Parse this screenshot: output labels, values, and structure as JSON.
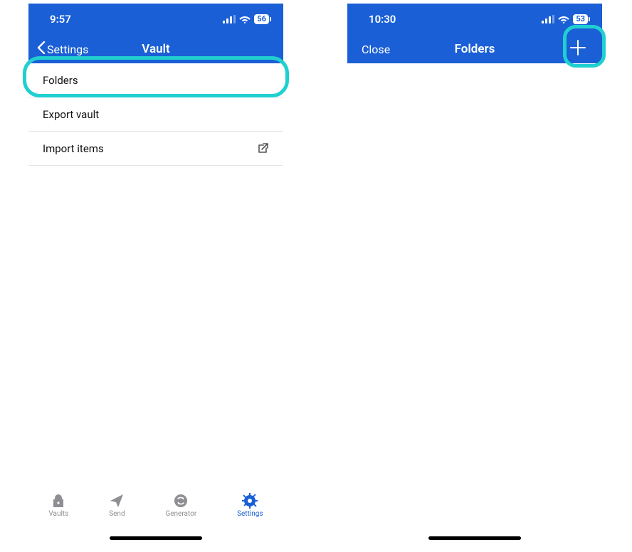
{
  "left": {
    "status": {
      "time": "9:57",
      "battery": "56"
    },
    "nav": {
      "back": "Settings",
      "title": "Vault"
    },
    "items": [
      {
        "label": "Folders",
        "external": false
      },
      {
        "label": "Export vault",
        "external": false
      },
      {
        "label": "Import items",
        "external": true
      }
    ],
    "tabs": [
      {
        "label": "Vaults"
      },
      {
        "label": "Send"
      },
      {
        "label": "Generator"
      },
      {
        "label": "Settings"
      }
    ]
  },
  "right": {
    "status": {
      "time": "10:30",
      "battery": "53"
    },
    "nav": {
      "close": "Close",
      "title": "Folders"
    }
  }
}
